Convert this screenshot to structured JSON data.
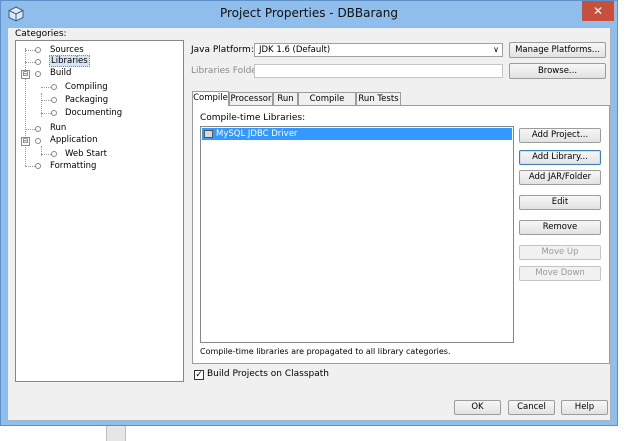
{
  "window": {
    "title": "Project Properties - DBBarang",
    "close_label": "✕"
  },
  "categories": {
    "label": "Categories:",
    "items": [
      {
        "label": "Sources"
      },
      {
        "label": "Libraries"
      },
      {
        "label": "Build",
        "expander": "⊟"
      },
      {
        "label": "Compiling"
      },
      {
        "label": "Packaging"
      },
      {
        "label": "Documenting"
      },
      {
        "label": "Run"
      },
      {
        "label": "Application",
        "expander": "⊟"
      },
      {
        "label": "Web Start"
      },
      {
        "label": "Formatting"
      }
    ]
  },
  "platform": {
    "label": "Java Platform:",
    "value": "JDK 1.6 (Default)",
    "arrow": "∨",
    "manage_label": "Manage Platforms..."
  },
  "libraries_folder": {
    "label": "Libraries Folder:",
    "value": "",
    "browse_label": "Browse..."
  },
  "tabs": [
    "Compile",
    "Processor",
    "Run",
    "Compile Tests",
    "Run Tests"
  ],
  "compile": {
    "list_label": "Compile-time Libraries:",
    "libraries": [
      "MySQL JDBC Driver"
    ],
    "note": "Compile-time libraries are propagated to all library categories."
  },
  "side_buttons": {
    "add_project": "Add Project...",
    "add_library": "Add Library...",
    "add_jar": "Add JAR/Folder",
    "edit": "Edit",
    "remove": "Remove",
    "move_up": "Move Up",
    "move_down": "Move Down"
  },
  "build_on_classpath": {
    "label": "Build Projects on Classpath",
    "checked": true,
    "check_glyph": "✓"
  },
  "dialog_buttons": {
    "ok": "OK",
    "cancel": "Cancel",
    "help": "Help"
  }
}
